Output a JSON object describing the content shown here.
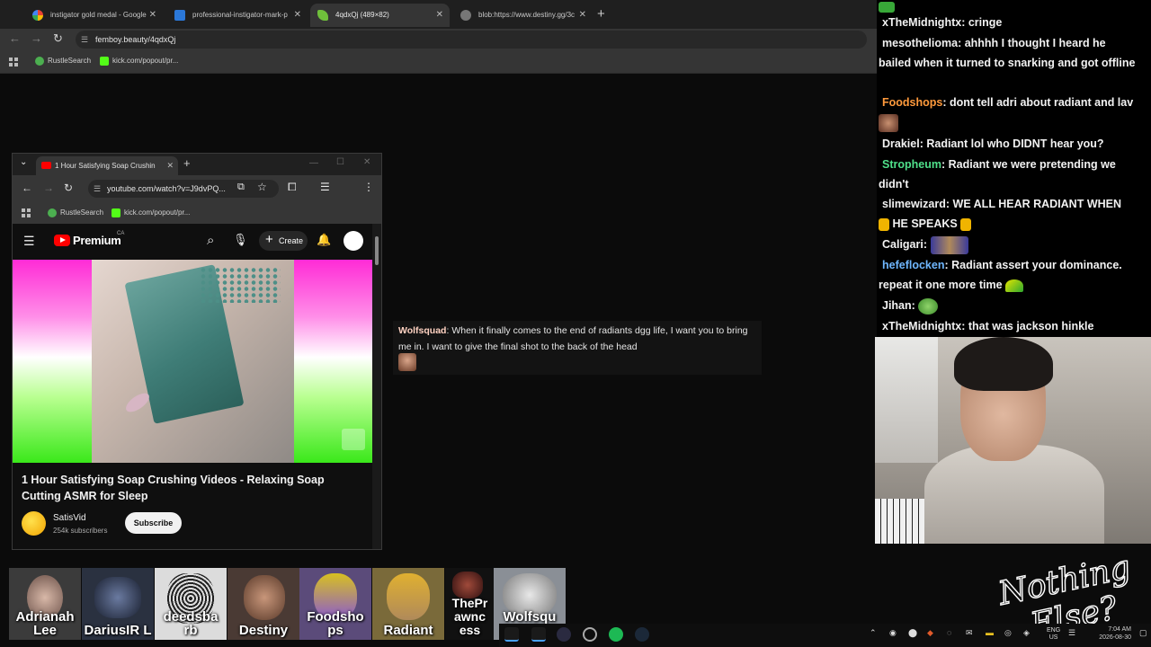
{
  "browser": {
    "tabs": [
      {
        "label": "instigator gold medal - Google",
        "favicon": "google-icon",
        "active": false
      },
      {
        "label": "professional-instigator-mark-p",
        "favicon": "image-icon",
        "active": false
      },
      {
        "label": "4qdxQj (489×82)",
        "favicon": "leaf-icon",
        "active": true
      },
      {
        "label": "blob:https://www.destiny.gg/3c",
        "favicon": "globe-icon",
        "active": false
      }
    ],
    "new_tab": "+",
    "url": "femboy.beauty/4qdxQj",
    "bookmarks": [
      {
        "label": "RustleSearch",
        "icon": "frog-icon"
      },
      {
        "label": "kick.com/popout/pr...",
        "icon": "kick-icon"
      }
    ]
  },
  "popup": {
    "tab_label": "1 Hour Satisfying Soap Crushin",
    "url": "youtube.com/watch?v=J9dvPQ...",
    "bookmarks": [
      {
        "label": "RustleSearch"
      },
      {
        "label": "kick.com/popout/pr..."
      }
    ],
    "youtube": {
      "brand": "Premium",
      "region": "CA",
      "create_label": "Create",
      "video_title": "1 Hour Satisfying Soap Crushing Videos - Relaxing Soap Cutting ASMR for Sleep",
      "channel_name": "SatisVid",
      "subscribers": "254k subscribers",
      "subscribe_label": "Subscribe"
    }
  },
  "overlay": {
    "user": "Wolfsquad",
    "message": "When it finally comes to the end of radiants dgg life, I want you to bring me in. I want to give the final shot to the back of the head"
  },
  "chat": {
    "messages": [
      {
        "user": "xTheMidnightx",
        "text": "cringe",
        "color": "#f2f2f2"
      },
      {
        "user": "mesothelioma",
        "text": "ahhhh I thought I heard he bailed when it turned to snarking and got offline",
        "color": "#f2f2f2"
      },
      {
        "user": "Foodshops",
        "text": "dont tell adri about radiant and lav",
        "color": "#ff9a3c"
      },
      {
        "user": "Drakiel",
        "text": "Radiant lol who DIDNT hear you?",
        "color": "#f2f2f2"
      },
      {
        "user": "Stropheum",
        "text": "Radiant we were pretending we didn't",
        "color": "#4fe08a"
      },
      {
        "user": "slimewizard",
        "text": "WE ALL HEAR RADIANT WHEN",
        "text2": "HE SPEAKS",
        "color": "#f2f2f2"
      },
      {
        "user": "Caligari",
        "text": "",
        "color": "#f2f2f2"
      },
      {
        "user": "hefeflocken",
        "text": "Radiant assert your dominance. repeat it one more time",
        "color": "#6fb7ff"
      },
      {
        "user": "Jihan",
        "text": "",
        "color": "#f2f2f2"
      },
      {
        "user": "xTheMidnightx",
        "text": "that was jackson hinkle",
        "color": "#f2f2f2"
      }
    ]
  },
  "streamers": [
    {
      "name": "Adrianah Lee",
      "bg": "#3b3b3b"
    },
    {
      "name": "DariusIRL",
      "bg": "#2a3140"
    },
    {
      "name": "deedsbarb",
      "bg": "#dcdcdc"
    },
    {
      "name": "Destiny",
      "bg": "#4a3a34"
    },
    {
      "name": "Foodshops",
      "bg": "#5b4b7a"
    },
    {
      "name": "Radiant",
      "bg": "#7a6a3a"
    },
    {
      "name": "ThePrawnceness",
      "bg": "#111111"
    },
    {
      "name": "Wolfsquad",
      "bg": "#8a8f96"
    }
  ],
  "streamer_labels": [
    "Adrianah Lee",
    "DariusIR L",
    "deedsba rb",
    "Destiny",
    "Foodsho ps",
    "Radiant",
    "ThePr awnc ess",
    "Wolfsqu ad"
  ],
  "logo_text": [
    "Nothing",
    "Else?"
  ],
  "taskbar": {
    "lang_top": "ENG",
    "lang_bottom": "US",
    "time": "7:04 AM",
    "date": "2026-08-30"
  }
}
